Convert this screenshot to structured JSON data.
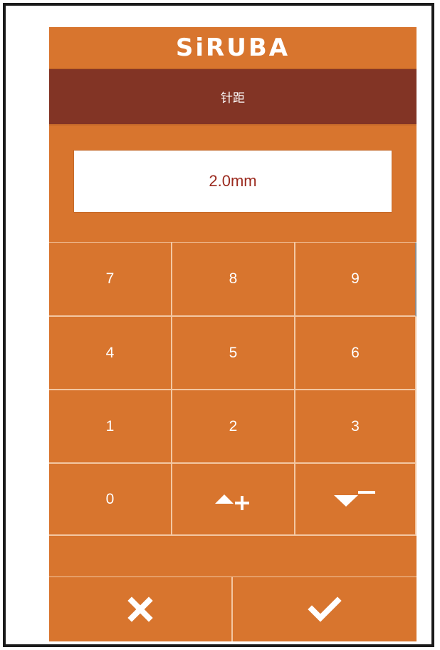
{
  "brand": {
    "logo_text": "SiRUBA"
  },
  "header": {
    "title": "针距"
  },
  "display": {
    "value": "2.0mm"
  },
  "keypad": {
    "keys": [
      "7",
      "8",
      "9",
      "4",
      "5",
      "6",
      "1",
      "2",
      "3",
      "0"
    ],
    "increment_icon": "triangle-up-plus-icon",
    "decrement_icon": "triangle-down-minus-icon"
  },
  "actions": {
    "cancel_icon": "close-icon",
    "confirm_icon": "checkmark-icon"
  },
  "colors": {
    "panel": "#d8752e",
    "title_bar": "#823425",
    "value_text": "#9b2a1e",
    "key_divider": "#f3c7a2"
  }
}
